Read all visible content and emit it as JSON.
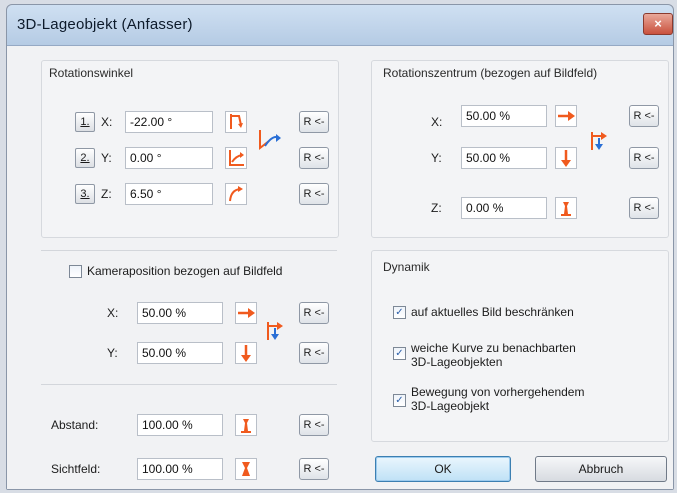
{
  "window": {
    "title": "3D-Lageobjekt (Anfasser)",
    "close_glyph": "×"
  },
  "rotation": {
    "title": "Rotationswinkel",
    "rows": [
      {
        "num": "1.",
        "axis": "X:",
        "value": "-22.00 °",
        "icon": "rotate-x-icon",
        "reset": "R <-"
      },
      {
        "num": "2.",
        "axis": "Y:",
        "value": "0.00 °",
        "icon": "rotate-y-icon",
        "reset": "R <-"
      },
      {
        "num": "3.",
        "axis": "Z:",
        "value": "6.50 °",
        "icon": "rotate-z-icon",
        "reset": "R <-"
      }
    ]
  },
  "center": {
    "title": "Rotationszentrum (bezogen auf Bildfeld)",
    "rows": [
      {
        "axis": "X:",
        "value": "50.00 %",
        "icon": "arrow-right-icon",
        "reset": "R <-"
      },
      {
        "axis": "Y:",
        "value": "50.00 %",
        "icon": "arrow-down-icon",
        "reset": "R <-"
      },
      {
        "axis": "Z:",
        "value": "0.00 %",
        "icon": "depth-icon",
        "reset": "R <-"
      }
    ]
  },
  "camera": {
    "checkbox_label": "Kameraposition bezogen auf Bildfeld",
    "checked": false,
    "rows": [
      {
        "axis": "X:",
        "value": "50.00 %",
        "icon": "arrow-right-icon",
        "reset": "R <-"
      },
      {
        "axis": "Y:",
        "value": "50.00 %",
        "icon": "arrow-down-icon",
        "reset": "R <-"
      }
    ]
  },
  "distance": {
    "label": "Abstand:",
    "value": "100.00 %",
    "reset": "R <-"
  },
  "fov": {
    "label": "Sichtfeld:",
    "value": "100.00 %",
    "reset": "R <-"
  },
  "dynamics": {
    "title": "Dynamik",
    "options": [
      {
        "label": "auf aktuelles Bild beschränken",
        "checked": true
      },
      {
        "label": "weiche Kurve zu benachbarten",
        "label2": "3D-Lageobjekten",
        "checked": true
      },
      {
        "label": "Bewegung von vorhergehendem",
        "label2": "3D-Lageobjekt",
        "checked": true
      }
    ]
  },
  "buttons": {
    "ok": "OK",
    "cancel": "Abbruch"
  },
  "colors": {
    "accent_orange": "#f05a1e",
    "accent_blue": "#2a6fd6"
  }
}
